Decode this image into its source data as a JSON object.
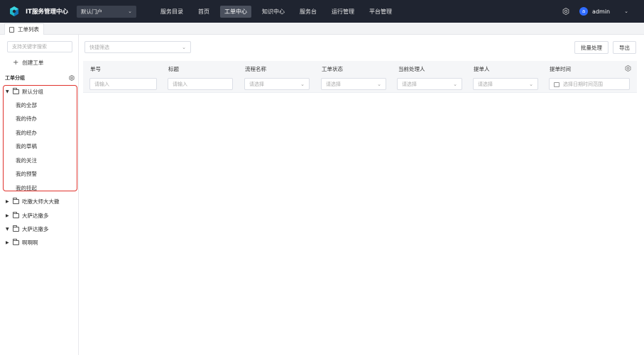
{
  "header": {
    "title": "IT服务管理中心",
    "portal_value": "默认门户",
    "nav": [
      "服务目录",
      "首页",
      "工单中心",
      "知识中心",
      "服务台",
      "运行管理",
      "平台管理"
    ],
    "active_nav": "工单中心",
    "avatar_letter": "a",
    "user": "admin",
    "colors": {
      "bar": "#1f2430",
      "active": "#4a505d",
      "avatar": "#2f6bff"
    }
  },
  "tabs": {
    "current": "工单列表"
  },
  "sidebar": {
    "search_placeholder": "支持关键字搜索",
    "create_label": "创建工单",
    "group_title": "工单分组",
    "default_group": "默认分组",
    "default_items": [
      "我的全部",
      "我的待办",
      "我的经办",
      "我的草稿",
      "我的关注",
      "我的预警",
      "我的挂起"
    ],
    "other_groups": [
      "吃撒大师大大撒",
      "大萨达撒多",
      "大萨达撒多",
      "啊啊啊"
    ],
    "highlight_color": "#e0322c"
  },
  "toolbar": {
    "filter_placeholder": "快捷筛选",
    "batch_label": "批量处理",
    "export_label": "导出"
  },
  "table": {
    "columns": [
      "单号",
      "标题",
      "流程名称",
      "工单状态",
      "当前处理人",
      "提单人",
      "提单时间"
    ],
    "filters": [
      "请输入",
      "请输入",
      "请选择",
      "请选择",
      "请选择",
      "请选择",
      "选择日期时间范围"
    ]
  }
}
